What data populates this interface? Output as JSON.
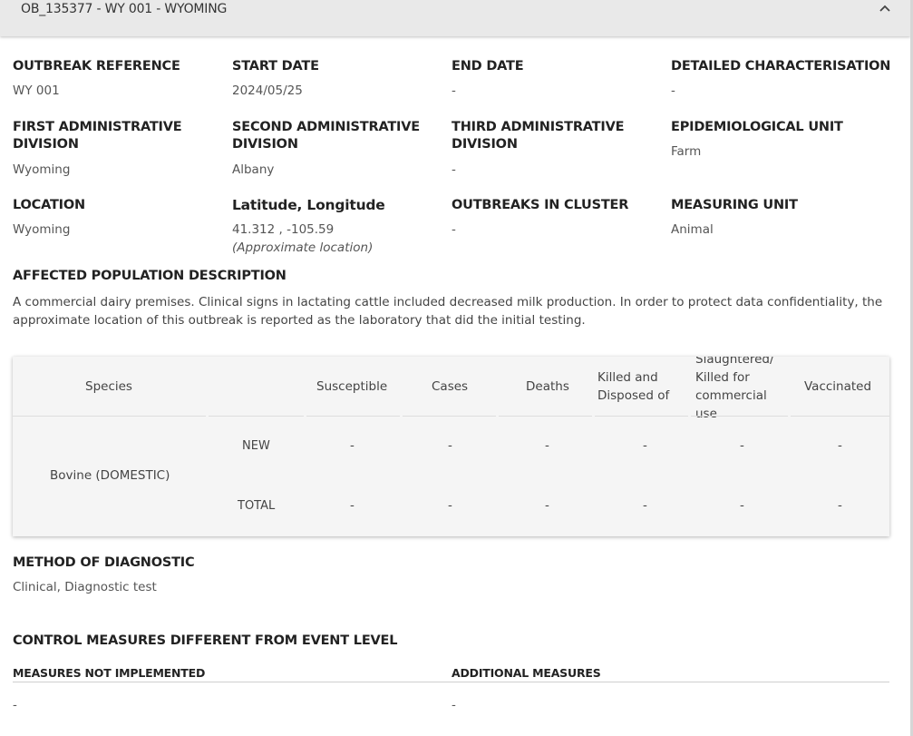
{
  "header": {
    "title": "OB_135377 - WY 001 - WYOMING",
    "collapse_icon": "chevron-up-icon"
  },
  "fields": {
    "outbreak_reference": {
      "label": "OUTBREAK REFERENCE",
      "value": "WY 001"
    },
    "start_date": {
      "label": "START DATE",
      "value": "2024/05/25"
    },
    "end_date": {
      "label": "END DATE",
      "value": "-"
    },
    "detailed_characterisation": {
      "label": "DETAILED CHARACTERISATION",
      "value": "-"
    },
    "first_admin_division": {
      "label_line1": "FIRST ADMINISTRATIVE",
      "label_line2": "DIVISION",
      "value": "Wyoming"
    },
    "second_admin_division": {
      "label_line1": "SECOND ADMINISTRATIVE",
      "label_line2": "DIVISION",
      "value": "Albany"
    },
    "third_admin_division": {
      "label_line1": "THIRD ADMINISTRATIVE",
      "label_line2": "DIVISION",
      "value": "-"
    },
    "epidemiological_unit": {
      "label": "EPIDEMIOLOGICAL UNIT",
      "value": "Farm"
    },
    "location": {
      "label": "LOCATION",
      "value": "Wyoming"
    },
    "lat_long": {
      "label": "Latitude, Longitude",
      "value": "41.312 , -105.59",
      "note": "(Approximate location)"
    },
    "outbreaks_in_cluster": {
      "label": "OUTBREAKS IN CLUSTER",
      "value": "-"
    },
    "measuring_unit": {
      "label": "MEASURING UNIT",
      "value": "Animal"
    }
  },
  "affected_population": {
    "label": "AFFECTED POPULATION DESCRIPTION",
    "text": "A commercial dairy premises. Clinical signs in lactating cattle included decreased milk production. In order to protect data confidentiality, the approximate location of this outbreak is reported as the laboratory that did the initial testing."
  },
  "species_table": {
    "headers": {
      "species": "Species",
      "susceptible": "Susceptible",
      "cases": "Cases",
      "deaths": "Deaths",
      "killed_line1": "Killed and",
      "killed_line2": "Disposed of",
      "slaughtered_line1": "Slaughtered/",
      "slaughtered_line2": "Killed for",
      "slaughtered_line3": "commercial",
      "slaughtered_line4": "use",
      "vaccinated": "Vaccinated"
    },
    "species_name": "Bovine (DOMESTIC)",
    "rows": [
      {
        "label": "NEW",
        "values": [
          "-",
          "-",
          "-",
          "-",
          "-",
          "-"
        ]
      },
      {
        "label": "TOTAL",
        "values": [
          "-",
          "-",
          "-",
          "-",
          "-",
          "-"
        ]
      }
    ]
  },
  "method_of_diagnostic": {
    "label": "METHOD OF DIAGNOSTIC",
    "value": "Clinical, Diagnostic test"
  },
  "control_measures": {
    "title": "CONTROL MEASURES DIFFERENT FROM EVENT LEVEL",
    "not_implemented_label": "MEASURES NOT IMPLEMENTED",
    "not_implemented_value": "-",
    "additional_label": "ADDITIONAL MEASURES",
    "additional_value": "-"
  }
}
